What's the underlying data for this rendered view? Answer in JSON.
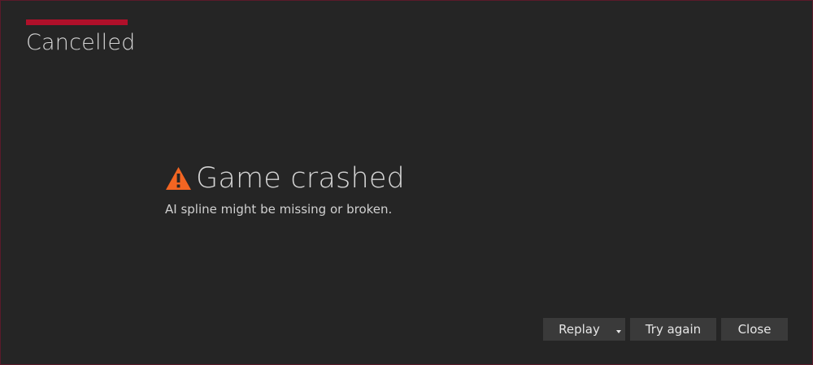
{
  "window": {
    "title": "Cancelled",
    "accent_color": "#b0102a"
  },
  "message": {
    "icon": "warning-icon",
    "icon_color": "#f26522",
    "title": "Game crashed",
    "body": "AI spline might be missing or broken."
  },
  "buttons": {
    "replay_label": "Replay",
    "replay_dropdown_icon": "caret-down-icon",
    "try_again_label": "Try again",
    "close_label": "Close"
  }
}
